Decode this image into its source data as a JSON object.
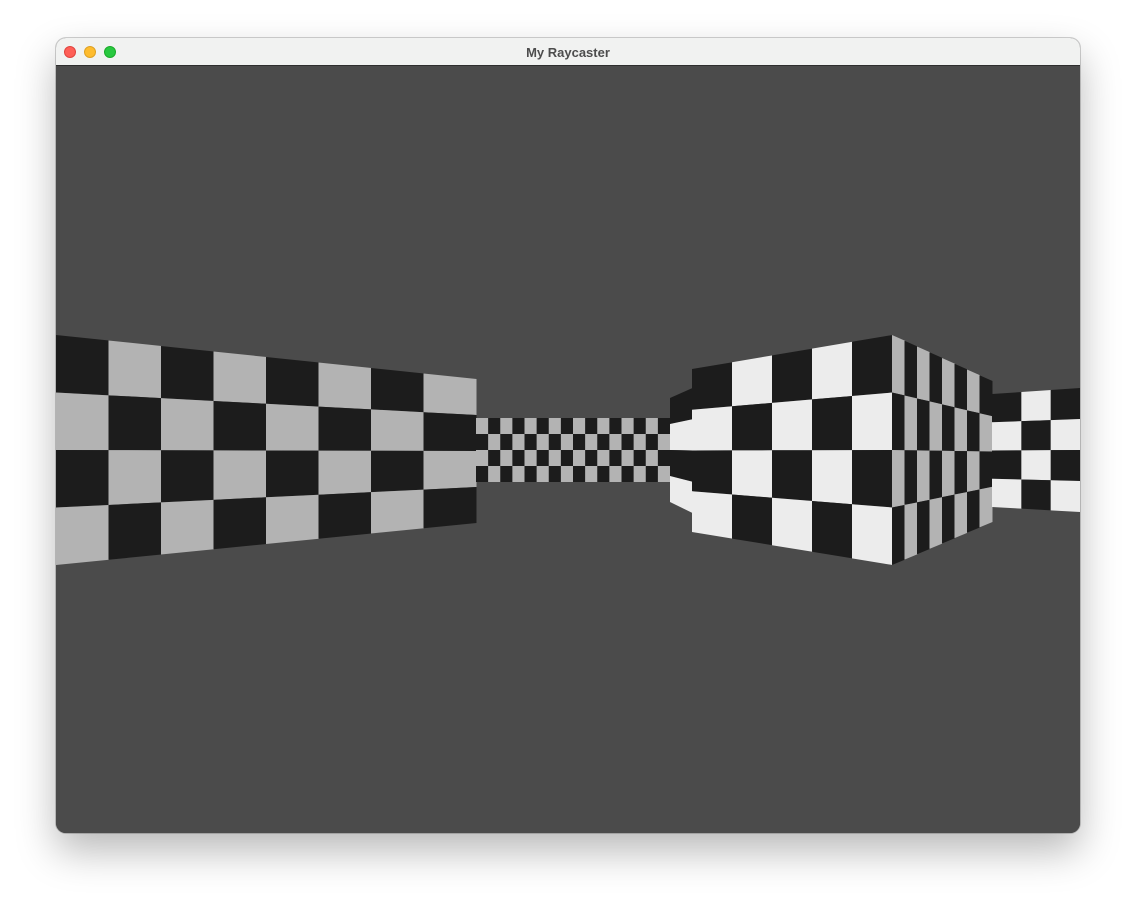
{
  "window": {
    "title": "My Raycaster",
    "controls": {
      "close": "close-button",
      "minimize": "minimize-button",
      "maximize": "zoom-button"
    }
  },
  "scene": {
    "ceiling_color": "#4b4b4b",
    "floor_color": "#4b4b4b",
    "wall_dark": "#1c1c1c",
    "wall_light_shaded": "#b3b3b3",
    "wall_light_lit": "#ececec",
    "wall_pattern": "checkerboard"
  }
}
